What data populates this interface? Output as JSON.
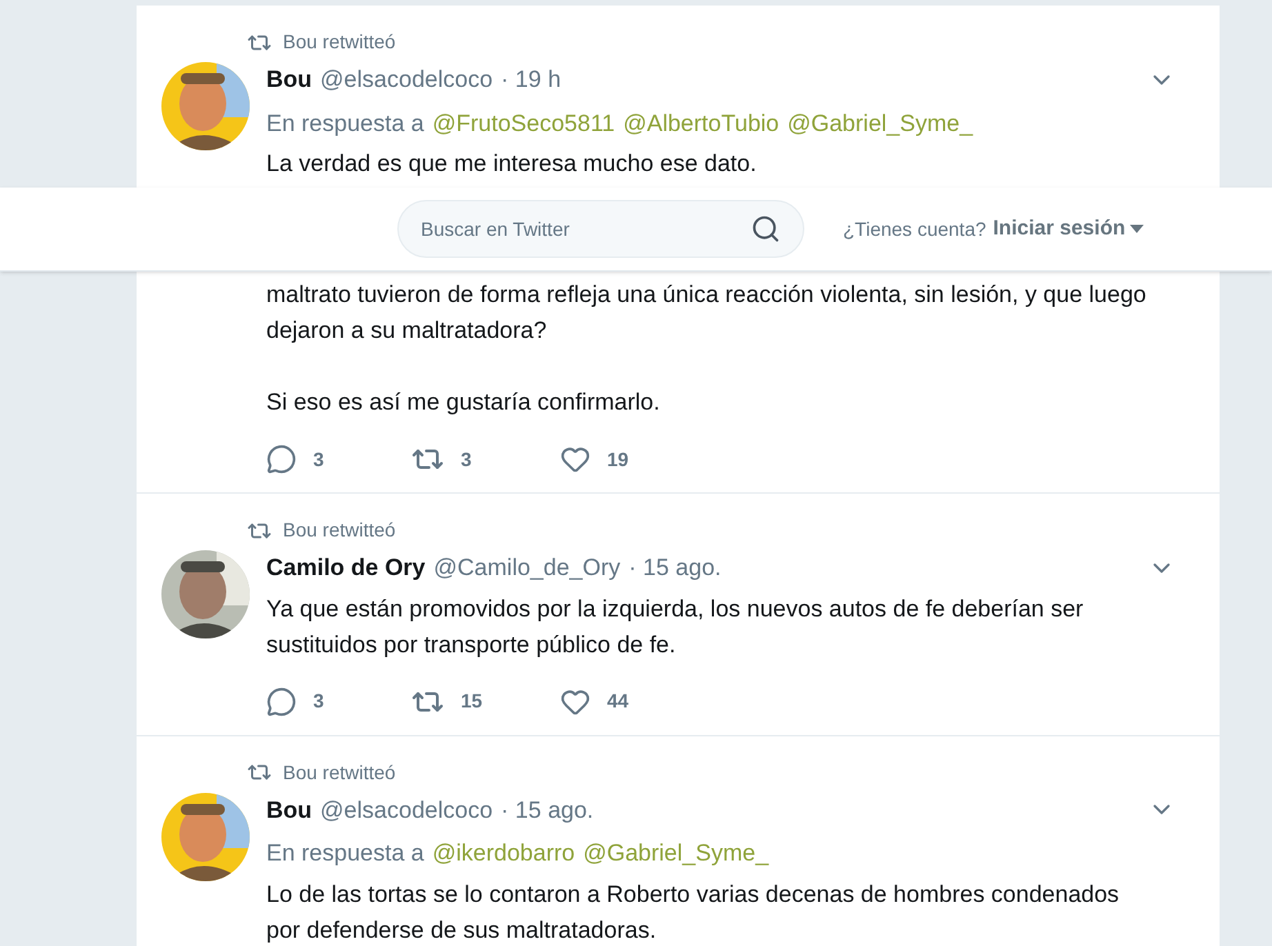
{
  "top_bar": {
    "search": {
      "placeholder": "Buscar en Twitter"
    },
    "account_prompt": "¿Tienes cuenta?",
    "login": "Iniciar sesión"
  },
  "tweets": [
    {
      "retweeted_by": "Bou retwitteó",
      "name": "Bou",
      "handle": "@elsacodelcoco",
      "time": "· 19 h",
      "reply_label": "En respuesta a",
      "reply_to": [
        "@FrutoSeco5811",
        "@AlbertoTubio",
        "@Gabriel_Syme_"
      ],
      "text_above_bar": "La verdad es que me interesa mucho ese dato.",
      "text": [
        "maltrato tuvieron de forma refleja una única reacción violenta, sin lesión, y que luego dejaron a su maltratadora?",
        "Si eso es así me gustaría confirmarlo."
      ],
      "replies": "3",
      "retweets": "3",
      "likes": "19"
    },
    {
      "retweeted_by": "Bou retwitteó",
      "name": "Camilo de Ory",
      "handle": "@Camilo_de_Ory",
      "time": "· 15 ago.",
      "text": [
        "Ya que están promovidos por la izquierda, los nuevos autos de fe deberían ser sustituidos por transporte público de fe."
      ],
      "replies": "3",
      "retweets": "15",
      "likes": "44"
    },
    {
      "retweeted_by": "Bou retwitteó",
      "name": "Bou",
      "handle": "@elsacodelcoco",
      "time": "· 15 ago.",
      "reply_label": "En respuesta a",
      "reply_to": [
        "@ikerdobarro",
        "@Gabriel_Syme_"
      ],
      "text": [
        "Lo de las tortas se lo contaron a Roberto varias decenas de hombres condenados por defenderse de sus maltratadoras."
      ]
    }
  ]
}
